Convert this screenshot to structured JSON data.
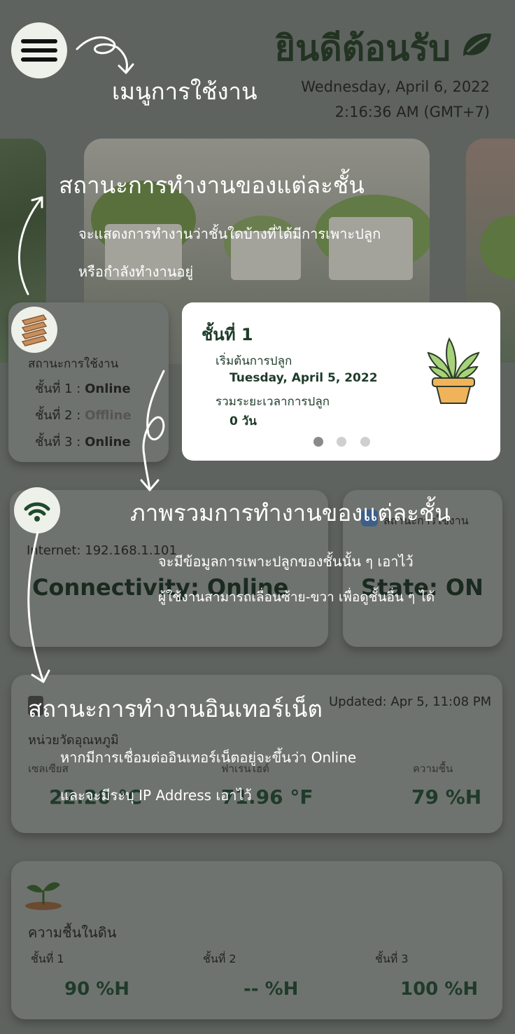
{
  "header": {
    "welcome": "ยินดีต้อนรับ",
    "date": "Wednesday, April 6, 2022",
    "time": "2:16:36 AM (GMT+7)"
  },
  "floor_status": {
    "title": "สถานะการใช้งาน",
    "rows": [
      {
        "label": "ชั้นที่ 1 :",
        "value": "Online"
      },
      {
        "label": "ชั้นที่ 2 :",
        "value": "Offline"
      },
      {
        "label": "ชั้นที่ 3 :",
        "value": "Online"
      }
    ]
  },
  "overview": {
    "title": "ชั้นที่ 1",
    "start_label": "เริ่มต้นการปลูก",
    "start_value": "Tuesday, April 5, 2022",
    "duration_label": "รวมระยะเวลาการปลูก",
    "duration_value": "0 วัน",
    "page_count": 3,
    "active_page": 1
  },
  "internet": {
    "ip": "Internet: 192.168.1.101",
    "status": "Connectivity: Online"
  },
  "state": {
    "label": "สถานะการใช้งาน",
    "value": "State: ON"
  },
  "temperature": {
    "updated": "Updated: Apr 5, 11:08 PM",
    "title": "หน่วยวัดอุณหภูมิ",
    "celsius_label": "เซลเซียส",
    "celsius_value": "22.20 °C",
    "fahrenheit_label": "ฟาเรนไฮต์",
    "fahrenheit_value": "71.96 °F",
    "humidity_label": "ความชื้น",
    "humidity_value": "79 %H"
  },
  "soil": {
    "title": "ความชื้นในดิน",
    "floors": [
      {
        "label": "ชั้นที่ 1",
        "value": "90 %H"
      },
      {
        "label": "ชั้นที่ 2",
        "value": "-- %H"
      },
      {
        "label": "ชั้นที่ 3",
        "value": "100 %H"
      }
    ]
  },
  "annotations": {
    "menu": "เมนูการใช้งาน",
    "floor_status_title": "สถานะการทำงานของแต่ละชั้น",
    "floor_status_line1": "จะแสดงการทำงานว่าชั้นใดบ้างที่ได้มีการเพาะปลูก",
    "floor_status_line2": "หรือกำลังทำงานอยู่",
    "overview_title": "ภาพรวมการทำงานของแต่ละชั้น",
    "overview_line1": "จะมีข้อมูลการเพาะปลูกของชั้นนั้น ๆ เอาไว้",
    "overview_line2": "ผู้ใช้งานสามารถเลื่อนซ้าย-ขวา เพื่อดูชั้นอื่น ๆ ได้",
    "internet_title": "สถานะการทำงานอินเทอร์เน็ต",
    "internet_line1": "หากมีการเชื่อมต่ออินเทอร์เน็ตอยู่จะขึ้นว่า Online",
    "internet_line2": "และจะมีระบุ IP Address เอาไว้"
  },
  "colors": {
    "overlay": "#5f6360",
    "card": "#6f736f",
    "accent": "#1f3b2a",
    "annotation": "#ffffff"
  }
}
